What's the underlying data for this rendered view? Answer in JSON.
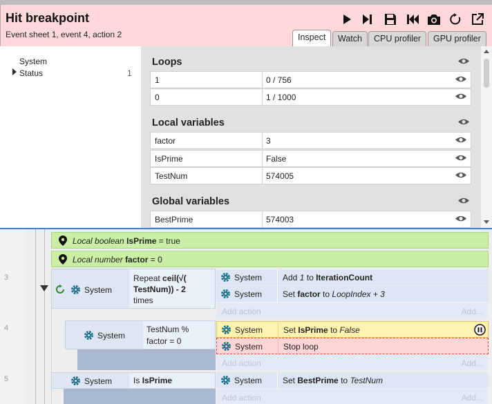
{
  "header": {
    "title": "Hit breakpoint",
    "subtitle": "Event sheet 1, event 4, action 2",
    "tabs": [
      "Inspect",
      "Watch",
      "CPU profiler",
      "GPU profiler"
    ]
  },
  "tree": {
    "root": "System",
    "child": "Status",
    "child_count": "1"
  },
  "inspector": {
    "sections": {
      "loops": {
        "title": "Loops",
        "rows": [
          {
            "key": "1",
            "value": "0 / 756"
          },
          {
            "key": "0",
            "value": "1 / 1000"
          }
        ]
      },
      "local": {
        "title": "Local variables",
        "rows": [
          {
            "key": "factor",
            "value": "3"
          },
          {
            "key": "IsPrime",
            "value": "False"
          },
          {
            "key": "TestNum",
            "value": "574005"
          }
        ]
      },
      "global": {
        "title": "Global variables",
        "rows": [
          {
            "key": "BestPrime",
            "value": "574003"
          }
        ]
      }
    }
  },
  "sheet": {
    "line_numbers": [
      "3",
      "4",
      "5"
    ],
    "local_bool": {
      "prefix": "Local boolean",
      "name": "IsPrime",
      "rest": "= true"
    },
    "local_num": {
      "prefix": "Local number",
      "name": "factor",
      "rest": "= 0"
    },
    "object_label": "System",
    "add_action": "Add action",
    "add_more": "Add...",
    "event3": {
      "cond_a": "Repeat",
      "cond_b": "ceil(√(",
      "cond_c": "TestNum)) - 2",
      "cond_d": "times",
      "a1": {
        "verb": "Add",
        "num": "1",
        "to": "to",
        "target": "IterationCount"
      },
      "a2": {
        "verb": "Set",
        "target": "factor",
        "to": "to",
        "expr": "LoopIndex + 3"
      }
    },
    "event4": {
      "cond_a": "TestNum %",
      "cond_b": "factor = 0",
      "a1": {
        "verb": "Set",
        "target": "IsPrime",
        "to": "to",
        "expr": "False"
      },
      "a2": {
        "text": "Stop loop"
      }
    },
    "event5": {
      "cond_prefix": "Is",
      "cond_name": "IsPrime",
      "a1": {
        "verb": "Set",
        "target": "BestPrime",
        "to": "to",
        "expr": "TestNum"
      }
    }
  },
  "colors": {
    "header_bg": "#ffd9d9",
    "breakpoint_action": "#fff3b0",
    "error_action": "#ffd5d5",
    "local_var_bg": "#c9eea4",
    "icon_teal": "#1b6f8a"
  }
}
